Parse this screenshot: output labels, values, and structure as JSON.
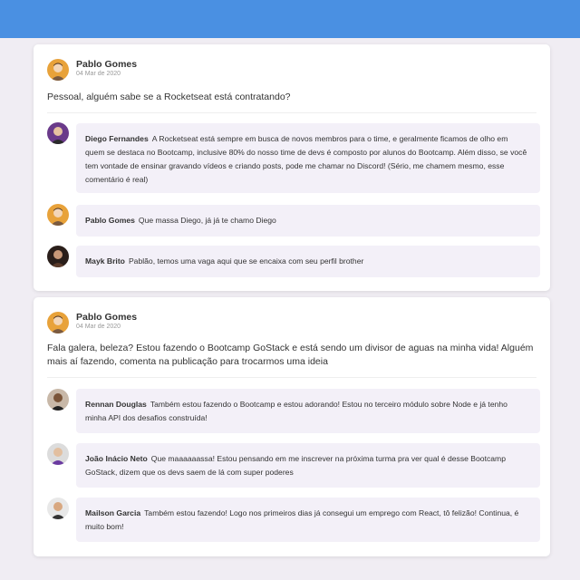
{
  "posts": [
    {
      "author": "Pablo Gomes",
      "date": "04 Mar de 2020",
      "content": "Pessoal, alguém sabe se a Rocketseat está contratando?",
      "comments": [
        {
          "author": "Diego Fernandes",
          "text": "A Rocketseat está sempre em busca de novos membros para o time, e geralmente ficamos de olho em quem se destaca no Bootcamp, inclusive 80% do nosso time de devs é composto por alunos do Bootcamp. Além disso, se você tem vontade de ensinar gravando vídeos e criando posts, pode me chamar no Discord! (Sério, me chamem mesmo, esse comentário é real)"
        },
        {
          "author": "Pablo Gomes",
          "text": "Que massa Diego, já já te chamo Diego"
        },
        {
          "author": "Mayk Brito",
          "text": "Pablão, temos uma vaga aqui que se encaixa com seu perfil brother"
        }
      ]
    },
    {
      "author": "Pablo Gomes",
      "date": "04 Mar de 2020",
      "content": "Fala galera, beleza? Estou fazendo o Bootcamp GoStack e está sendo um divisor de aguas na minha vida! Alguém mais aí fazendo, comenta na publicação para trocarmos uma ideia",
      "comments": [
        {
          "author": "Rennan Douglas",
          "text": "Também estou fazendo o Bootcamp e estou adorando! Estou no terceiro módulo sobre Node e já tenho minha API dos desafios construída!"
        },
        {
          "author": "João Inácio Neto",
          "text": "Que maaaaaassa! Estou pensando em me inscrever na próxima turma pra ver qual é desse Bootcamp GoStack, dizem que os devs saem de lá com super poderes"
        },
        {
          "author": "Mailson Garcia",
          "text": "Também estou fazendo! Logo nos primeiros dias já consegui um emprego com React, tô felizão! Continua, é muito bom!"
        }
      ]
    }
  ],
  "colors": {
    "header": "#4a90e2",
    "background": "#f0edf3",
    "bubble": "#f3f0f8"
  },
  "icons": {
    "avatar": "user-avatar-icon"
  }
}
